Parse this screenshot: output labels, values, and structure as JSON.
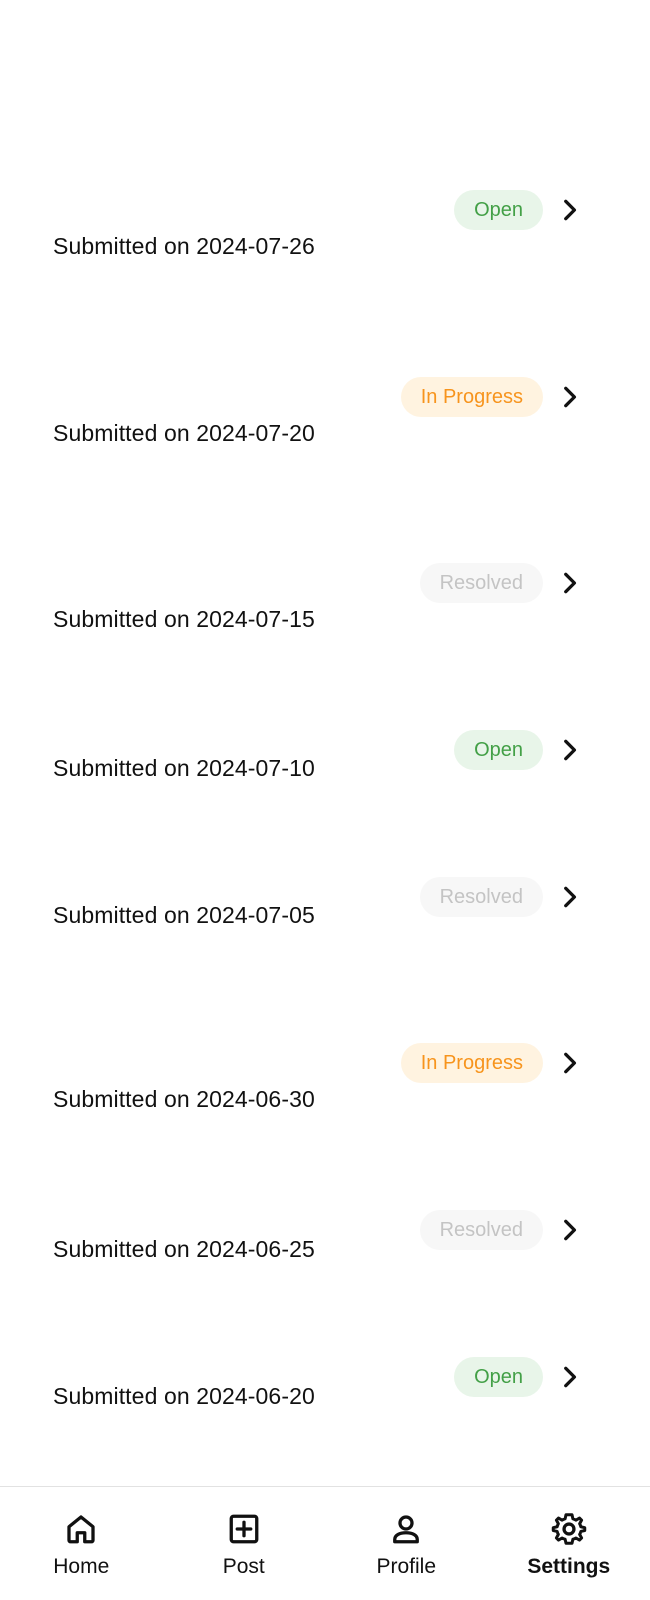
{
  "requests": [
    {
      "date_text": "Submitted on 2024-07-26",
      "status": "Open",
      "status_kind": "open"
    },
    {
      "date_text": "Submitted on 2024-07-20",
      "status": "In Progress",
      "status_kind": "progress"
    },
    {
      "date_text": "Submitted on 2024-07-15",
      "status": "Resolved",
      "status_kind": "resolved"
    },
    {
      "date_text": "Submitted on 2024-07-10",
      "status": "Open",
      "status_kind": "open"
    },
    {
      "date_text": "Submitted on 2024-07-05",
      "status": "Resolved",
      "status_kind": "resolved"
    },
    {
      "date_text": "Submitted on 2024-06-30",
      "status": "In Progress",
      "status_kind": "progress"
    },
    {
      "date_text": "Submitted on 2024-06-25",
      "status": "Resolved",
      "status_kind": "resolved"
    },
    {
      "date_text": "Submitted on 2024-06-20",
      "status": "Open",
      "status_kind": "open"
    }
  ],
  "row_icon": "chevron-right-icon",
  "status_colors": {
    "open": {
      "text": "#43a047",
      "background": "#e8f5e9"
    },
    "progress": {
      "text": "#f7941d",
      "background": "#fff3e0"
    },
    "resolved": {
      "text": "#c4c4c4",
      "background": "#f7f7f7"
    }
  },
  "tab_bar": {
    "tabs": [
      {
        "label": "Home",
        "icon": "home-icon"
      },
      {
        "label": "Post",
        "icon": "plus-square-icon"
      },
      {
        "label": "Profile",
        "icon": "person-icon"
      },
      {
        "label": "Settings",
        "icon": "gear-icon"
      }
    ],
    "active": "Settings"
  }
}
